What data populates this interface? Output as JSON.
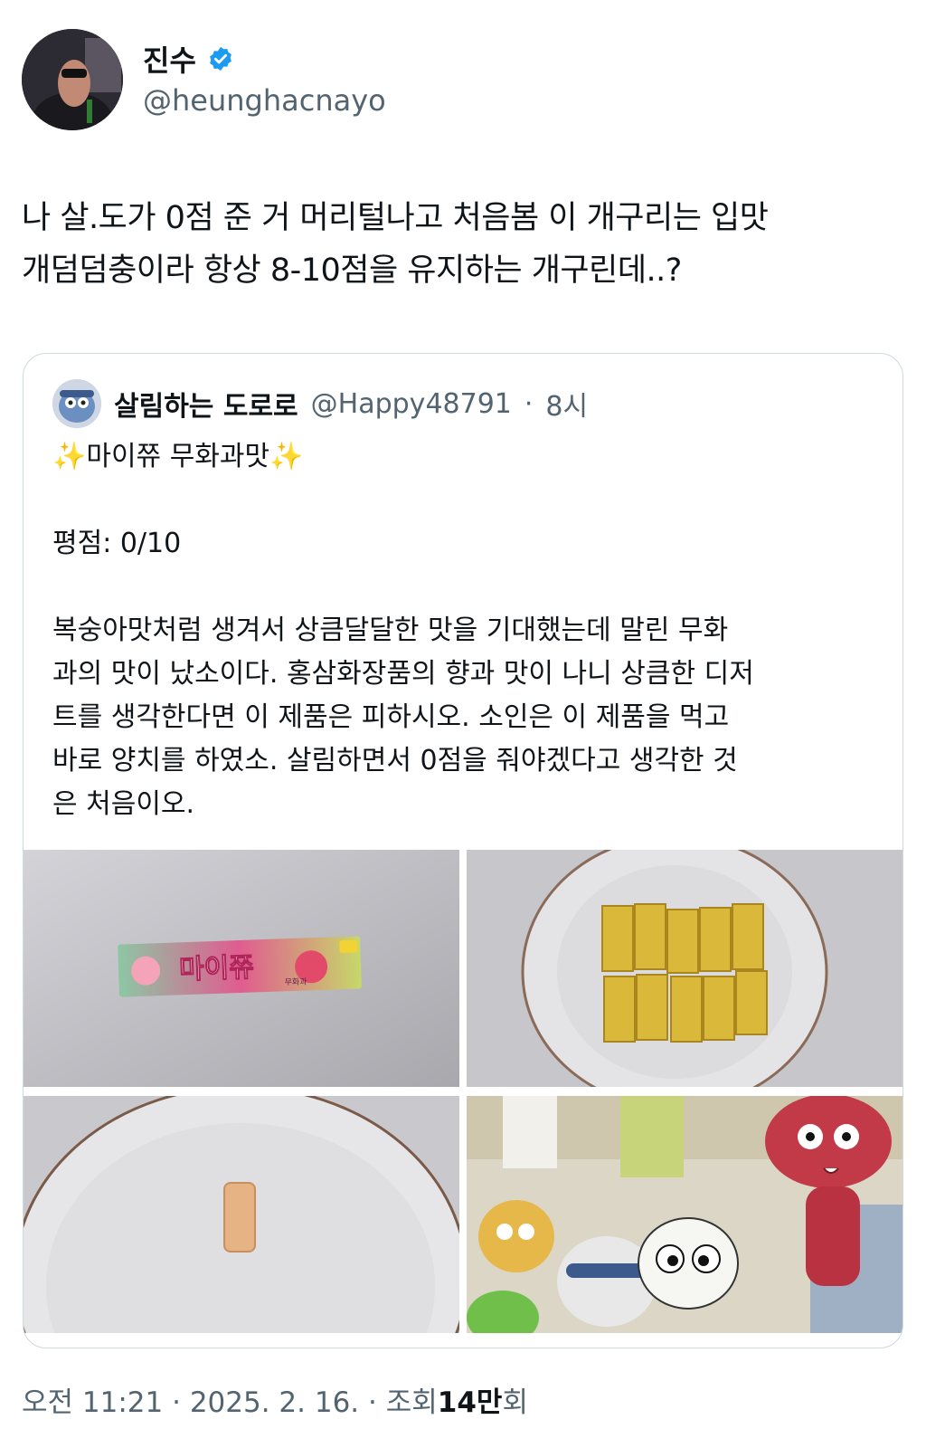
{
  "author": {
    "name": "진수",
    "handle": "@heunghacnayo",
    "verified": true,
    "verified_color": "#1d9bf0"
  },
  "tweet": {
    "text": "나 살.도가 0점 준 거 머리털나고 처음봄 이 개구리는 입맛\n개덤덤충이라 항상 8-10점을 유지하는 개구린데..?"
  },
  "quote": {
    "name": "살림하는 도로로",
    "handle": "@Happy48791",
    "separator": "·",
    "time": "8시",
    "title": "✨마이쮸 무화과맛✨",
    "rating": "평점: 0/10",
    "body": "복숭아맛처럼 생겨서 상큼달달한 맛을 기대했는데 말린 무화\n과의 맛이 났소이다. 홍삼화장품의 향과 맛이 나니 상큼한 디저\n트를 생각한다면 이 제품은 피하시오. 소인은 이 제품을 먹고\n바로 양치를 하였소. 살림하면서 0점을 줘야겠다고 생각한 것\n은 처음이오.",
    "media": [
      {
        "alt": "마이쮸 무화과맛 package",
        "package_text": "마이쮸",
        "package_subtext": "무화과"
      },
      {
        "alt": "gold-wrapped candies on a plate"
      },
      {
        "alt": "single unwrapped candy on a plate"
      },
      {
        "alt": "Keroro cartoon frame"
      }
    ]
  },
  "meta": {
    "time": "오전 11:21",
    "sep1": "·",
    "date": "2025. 2. 16.",
    "sep2": "·",
    "views_label": "조회",
    "views_count": "14만",
    "views_suffix": "회"
  }
}
